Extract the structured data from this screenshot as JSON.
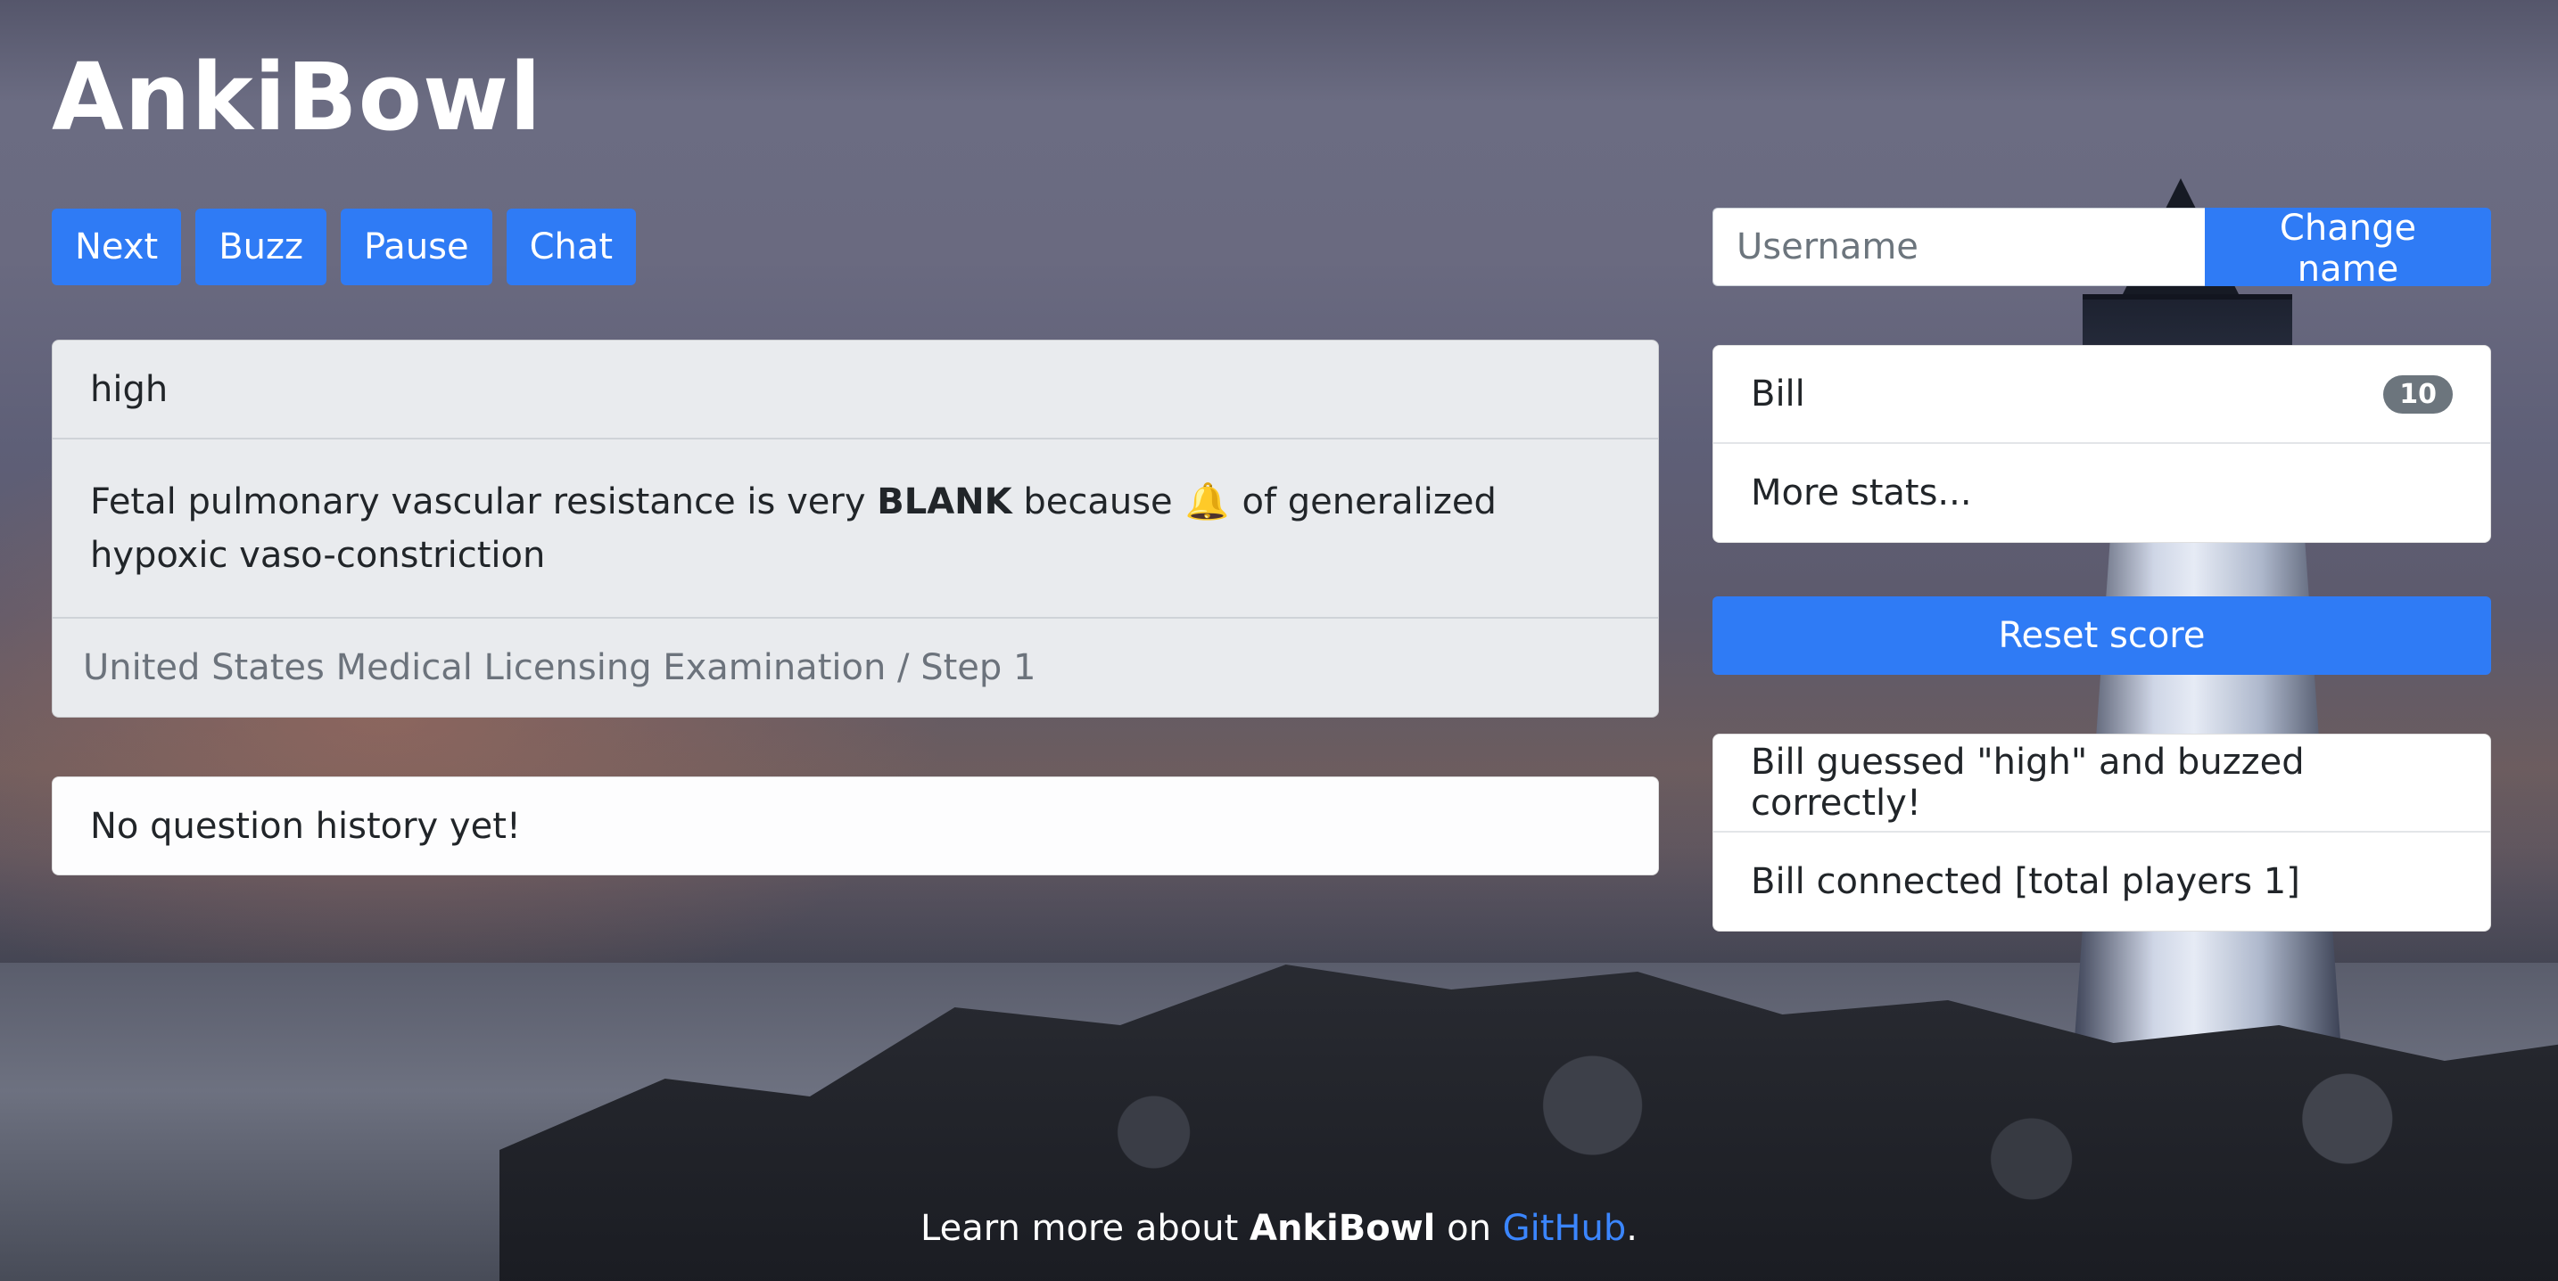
{
  "app": {
    "title": "AnkiBowl"
  },
  "toolbar": {
    "next_label": "Next",
    "buzz_label": "Buzz",
    "pause_label": "Pause",
    "chat_label": "Chat"
  },
  "question": {
    "answer": "high",
    "text_before": "Fetal pulmonary vascular resistance is very",
    "blank": "BLANK",
    "text_middle": "because",
    "bell_glyph": "🔔",
    "text_after": "of generalized hypoxic vaso-constriction",
    "source": "United States Medical Licensing Examination / Step 1"
  },
  "history": {
    "empty_message": "No question history yet!"
  },
  "user": {
    "username_placeholder": "Username",
    "change_name_label": "Change name"
  },
  "scores": {
    "players": [
      {
        "name": "Bill",
        "score": "10"
      }
    ],
    "more_stats_label": "More stats..."
  },
  "reset_label": "Reset score",
  "log": [
    "Bill guessed \"high\" and buzzed correctly!",
    "Bill connected [total players 1]"
  ],
  "footer": {
    "prefix": "Learn more about",
    "brand": "AnkiBowl",
    "middle": "on",
    "link_label": "GitHub",
    "suffix": "."
  },
  "colors": {
    "primary": "#2f7bf5",
    "badge": "#6c757d",
    "bell": "#f3a13b",
    "link": "#3b86ff"
  },
  "icons": {
    "bell": "bell-icon"
  }
}
